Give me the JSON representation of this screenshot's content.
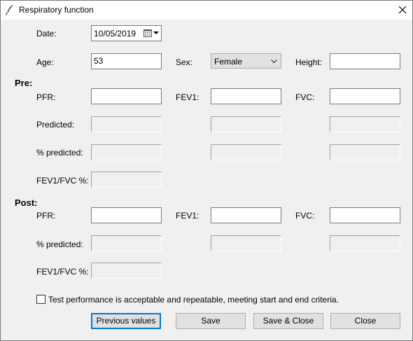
{
  "window": {
    "title": "Respiratory function"
  },
  "labels": {
    "date": "Date:",
    "age": "Age:",
    "sex": "Sex:",
    "height": "Height:"
  },
  "fields": {
    "date": "10/05/2019",
    "age": "53",
    "sex": "Female",
    "height": ""
  },
  "pre": {
    "heading": "Pre:",
    "pfr_label": "PFR:",
    "fev1_label": "FEV1:",
    "fvc_label": "FVC:",
    "predicted_label": "Predicted:",
    "pct_predicted_label": "% predicted:",
    "ratio_label": "FEV1/FVC %:"
  },
  "post": {
    "heading": "Post:",
    "pfr_label": "PFR:",
    "fev1_label": "FEV1:",
    "fvc_label": "FVC:",
    "pct_predicted_label": "% predicted:",
    "ratio_label": "FEV1/FVC %:"
  },
  "acceptable": {
    "label": "Test performance is acceptable and repeatable, meeting start and end criteria.",
    "checked": false
  },
  "buttons": {
    "previous": "Previous values",
    "save": "Save",
    "save_close": "Save & Close",
    "close": "Close"
  },
  "colors": {
    "window_bg": "#f0f0f0",
    "focus_border": "#0078d7"
  }
}
